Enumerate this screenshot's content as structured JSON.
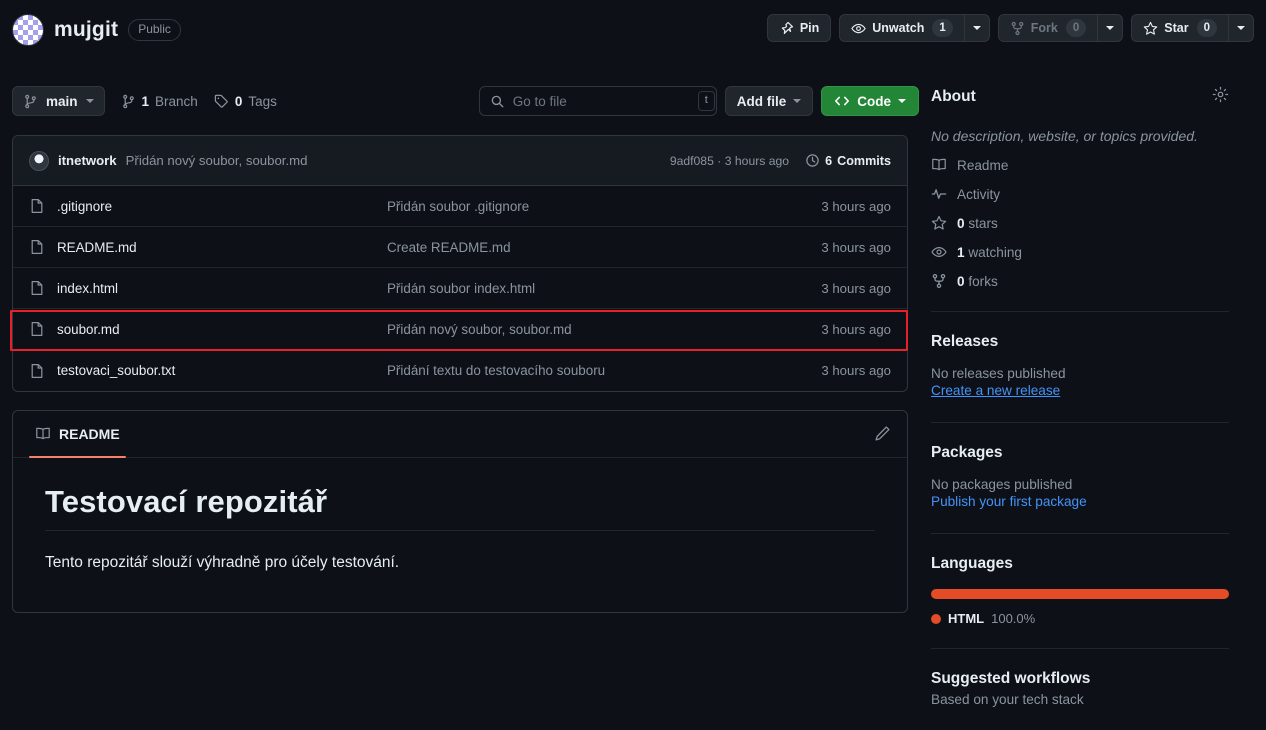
{
  "header": {
    "repo_name": "mujgit",
    "visibility": "Public",
    "avatar_icon": "checkered-avatar-icon",
    "actions": {
      "pin_label": "Pin",
      "pin_icon": "pin-icon",
      "unwatch_label": "Unwatch",
      "unwatch_icon": "eye-icon",
      "unwatch_count": "1",
      "fork_label": "Fork",
      "fork_icon": "fork-icon",
      "fork_count": "0",
      "star_label": "Star",
      "star_icon": "star-icon",
      "star_count": "0"
    }
  },
  "toolbar": {
    "branch_label": "main",
    "branch_icon": "branch-icon",
    "branch_count_label": "Branch",
    "branch_count": "1",
    "tags_count": "0",
    "tags_label": "Tags",
    "tags_icon": "tag-icon",
    "search_placeholder": "Go to file",
    "search_value": "",
    "search_icon": "search-icon",
    "search_kbd": "t",
    "add_file_label": "Add file",
    "code_label": "Code",
    "code_icon": "code-brackets-icon"
  },
  "commit_bar": {
    "author": "itnetwork",
    "message": "Přidán nový soubor, soubor.md",
    "hash": "9adf085",
    "separator": "·",
    "time": "3 hours ago",
    "commits_count": "6",
    "commits_label": "Commits",
    "history_icon": "history-clock-icon"
  },
  "files": [
    {
      "name": ".gitignore",
      "icon": "file-icon",
      "message": "Přidán soubor .gitignore",
      "time": "3 hours ago"
    },
    {
      "name": "README.md",
      "icon": "file-icon",
      "message": "Create README.md",
      "time": "3 hours ago"
    },
    {
      "name": "index.html",
      "icon": "file-icon",
      "message": "Přidán soubor index.html",
      "time": "3 hours ago"
    },
    {
      "name": "soubor.md",
      "icon": "file-icon",
      "message": "Přidán nový soubor, soubor.md",
      "time": "3 hours ago"
    },
    {
      "name": "testovaci_soubor.txt",
      "icon": "file-icon",
      "message": "Přidání textu do testovacího souboru",
      "time": "3 hours ago"
    }
  ],
  "annotation": {
    "target_row": "soubor.md",
    "color": "#e8202a"
  },
  "readme": {
    "tab_label": "README",
    "tab_icon": "book-icon",
    "edit_icon": "pencil-icon",
    "heading": "Testovací repozitář",
    "paragraph": "Tento repozitář slouží výhradně pro účely testování.",
    "accent_color": "#f78166"
  },
  "sidebar": {
    "about_title": "About",
    "gear_icon": "gear-icon",
    "description": "No description, website, or topics provided.",
    "links": [
      {
        "label": "Readme",
        "icon": "book-icon"
      },
      {
        "label": "Activity",
        "icon": "pulse-icon"
      },
      {
        "label": "0 stars",
        "icon": "star-icon",
        "count": "0",
        "noun": "stars"
      },
      {
        "label": "1 watching",
        "icon": "eye-icon",
        "count": "1",
        "noun": "watching"
      },
      {
        "label": "0 forks",
        "icon": "fork-icon",
        "count": "0",
        "noun": "forks"
      }
    ],
    "releases": {
      "title": "Releases",
      "empty_text": "No releases published",
      "link_text": "Create a new release"
    },
    "packages": {
      "title": "Packages",
      "empty_text": "No packages published",
      "link_text": "Publish your first package"
    },
    "languages": {
      "title": "Languages",
      "items": [
        {
          "name": "HTML",
          "percent": "100.0%",
          "value": 100,
          "color": "#e34c26"
        }
      ]
    },
    "workflows": {
      "title": "Suggested workflows",
      "subtitle": "Based on your tech stack"
    }
  },
  "colors": {
    "background": "#0d1117",
    "surface": "#161b22",
    "border": "#30363d",
    "text": "#e6edf3",
    "muted": "#8b949e",
    "link": "#4493f8",
    "green": "#238636",
    "annotation": "#e8202a"
  }
}
